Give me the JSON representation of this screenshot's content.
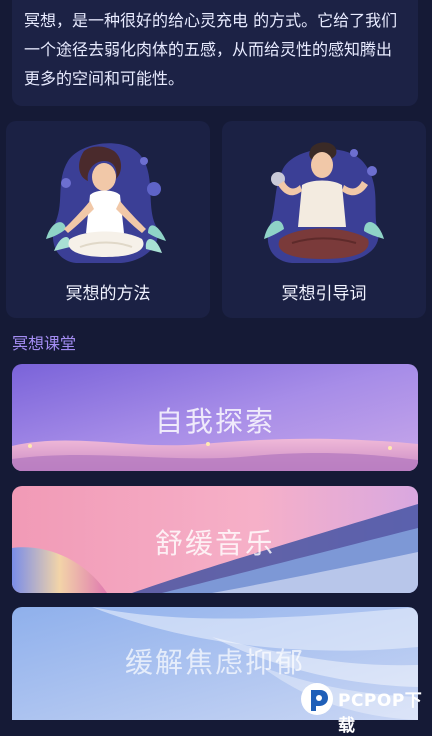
{
  "intro": {
    "text": "冥想，是一种很好的给心灵充电 的方式。它给了我们一个途径去弱化肉体的五感，从而给灵性的感知腾出更多的空间和可能性。"
  },
  "method_cards": [
    {
      "label": "冥想的方法",
      "icon": "meditating-woman-illustration"
    },
    {
      "label": "冥想引导词",
      "icon": "meditating-man-illustration"
    }
  ],
  "section": {
    "title": "冥想课堂"
  },
  "courses": [
    {
      "label": "自我探索",
      "theme": "purple-dunes"
    },
    {
      "label": "舒缓音乐",
      "theme": "pink-sky-grass"
    },
    {
      "label": "缓解焦虑抑郁",
      "theme": "blue-waves"
    }
  ],
  "watermark": {
    "text": "PCPOP下载"
  },
  "colors": {
    "background": "#151a36",
    "card": "#1c2245",
    "section_title": "#a48df3"
  }
}
